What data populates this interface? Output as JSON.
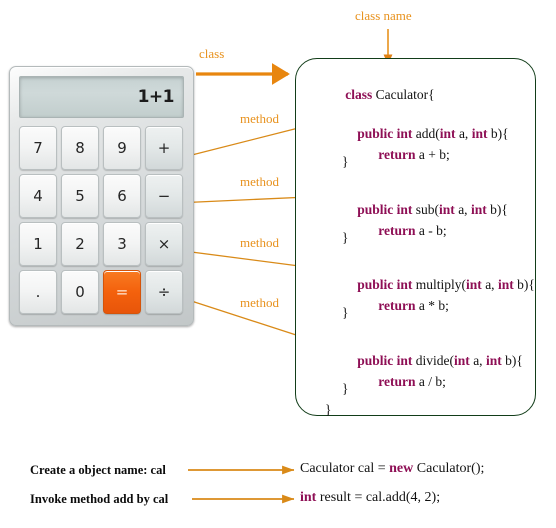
{
  "annotations": {
    "class_label": "class",
    "class_name_label": "class name",
    "method_labels": [
      "method",
      "method",
      "method",
      "method"
    ]
  },
  "calculator": {
    "display_value": "1+1",
    "keys": [
      {
        "label": "7",
        "type": "digit"
      },
      {
        "label": "8",
        "type": "digit"
      },
      {
        "label": "9",
        "type": "digit"
      },
      {
        "label": "+",
        "type": "operator"
      },
      {
        "label": "4",
        "type": "digit"
      },
      {
        "label": "5",
        "type": "digit"
      },
      {
        "label": "6",
        "type": "digit"
      },
      {
        "label": "−",
        "type": "operator"
      },
      {
        "label": "1",
        "type": "digit"
      },
      {
        "label": "2",
        "type": "digit"
      },
      {
        "label": "3",
        "type": "digit"
      },
      {
        "label": "×",
        "type": "operator"
      },
      {
        "label": ".",
        "type": "digit"
      },
      {
        "label": "0",
        "type": "digit"
      },
      {
        "label": "=",
        "type": "equals"
      },
      {
        "label": "÷",
        "type": "operator"
      }
    ]
  },
  "code": {
    "class_keyword": "class",
    "class_signature": " Caculator{",
    "methods": [
      {
        "modifier": "public",
        "return_type": "int",
        "name": " add(",
        "param_type_1": "int",
        "param_1": " a, ",
        "param_type_2": "int",
        "param_2": " b){",
        "return_keyword": "return",
        "return_expr": " a + b;",
        "close": "}"
      },
      {
        "modifier": "public",
        "return_type": "int",
        "name": " sub(",
        "param_type_1": "int",
        "param_1": " a, ",
        "param_type_2": "int",
        "param_2": " b){",
        "return_keyword": "return",
        "return_expr": " a - b;",
        "close": "}"
      },
      {
        "modifier": "public",
        "return_type": "int",
        "name": " multiply(",
        "param_type_1": "int",
        "param_1": " a, ",
        "param_type_2": "int",
        "param_2": " b){",
        "return_keyword": "return",
        "return_expr": " a * b;",
        "close": "}"
      },
      {
        "modifier": "public",
        "return_type": "int",
        "name": " divide(",
        "param_type_1": "int",
        "param_1": " a, ",
        "param_type_2": "int",
        "param_2": " b){",
        "return_keyword": "return",
        "return_expr": " a / b;",
        "close": "}"
      }
    ],
    "class_close": "}"
  },
  "bottom": {
    "rows": [
      {
        "label": "Create a object name: cal",
        "code_prefix": "Caculator cal = ",
        "code_keyword": "new",
        "code_suffix": " Caculator();"
      },
      {
        "label": "Invoke method add by cal",
        "code_prefix": "",
        "code_keyword": "int",
        "code_suffix": " result = cal.add(4, 2);"
      }
    ]
  },
  "colors": {
    "annotation_orange": "#E8921E",
    "arrow_orange": "#E08214",
    "keyword_magenta": "#8E0F55",
    "box_green": "#123d19",
    "equals_orange": "#F4620D"
  }
}
